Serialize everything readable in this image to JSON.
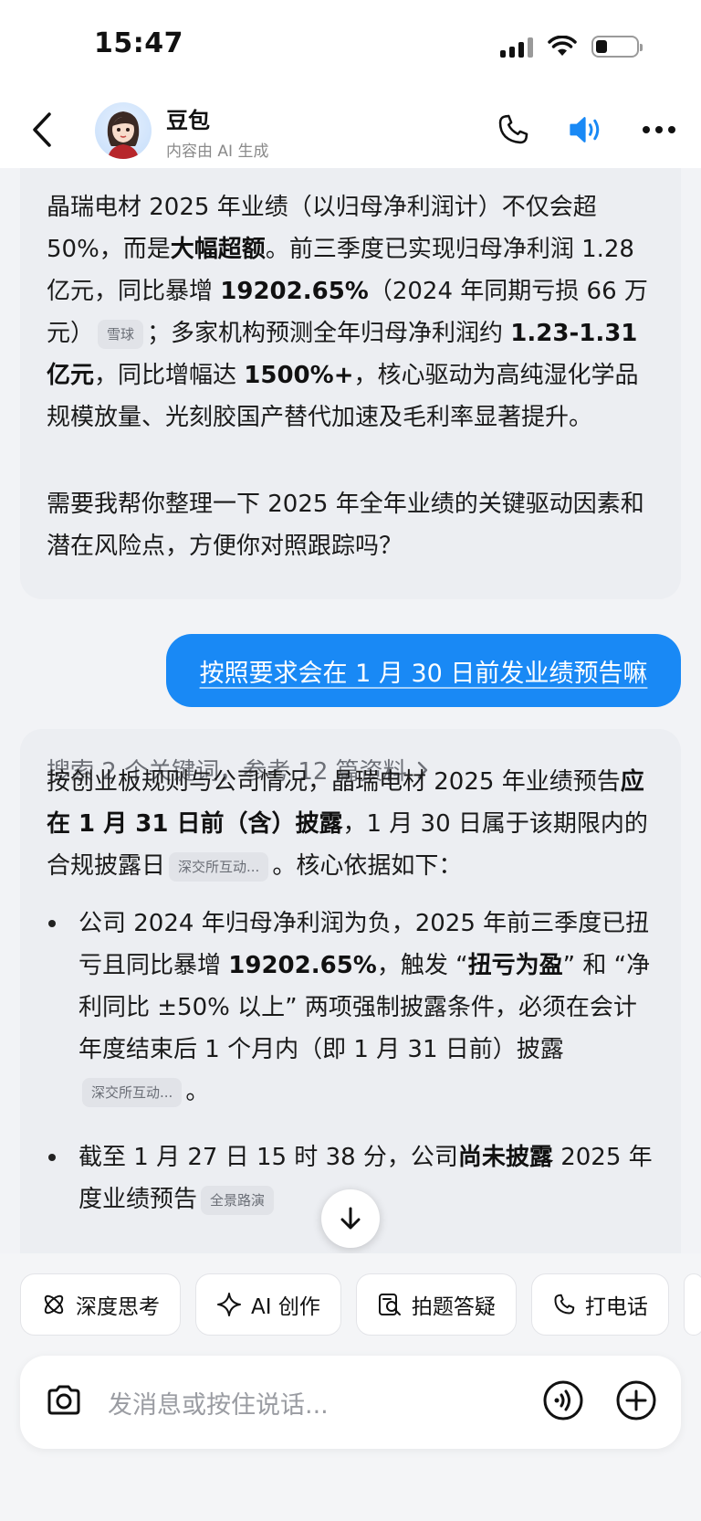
{
  "status_bar": {
    "time": "15:47"
  },
  "header": {
    "title": "豆包",
    "subtitle": "内容由 AI 生成"
  },
  "messages": {
    "ai_1": {
      "p1_pre": "晶瑞电材 2025 年业绩（以归母净利润计）不仅会超 50%，而是",
      "p1_b1": "大幅超额",
      "p1_mid1": "。前三季度已实现归母净利润 1.28 亿元，同比暴增 ",
      "p1_b2": "19202.65%",
      "p1_mid2": "（2024 年同期亏损 66 万元）",
      "cite1": "雪球",
      "p1_mid3": "；多家机构预测全年归母净利润约 ",
      "p1_b3": "1.23-1.31 亿元",
      "p1_mid4": "，同比增幅达 ",
      "p1_b4": "1500%+",
      "p1_end": "，核心驱动为高纯湿化学品规模放量、光刻胶国产替代加速及毛利率显著提升。",
      "p2": "需要我帮你整理一下 2025 年全年业绩的关键驱动因素和潜在风险点，方便你对照跟踪吗？"
    },
    "user_1": "按照要求会在 1 月 30 日前发业绩预告嘛",
    "ai_2": {
      "search": "搜索 2 个关键词，参考 12 篇资料",
      "p1_pre": "按创业板规则与公司情况，晶瑞电材 2025 年业绩预告",
      "p1_b1": "应在 1 月 31 日前（含）披露",
      "p1_mid": "，1 月 30 日属于该期限内的合规披露日",
      "cite1": "深交所互动...",
      "p1_end": "。核心依据如下：",
      "b1_pre": "公司 2024 年归母净利润为负，2025 年前三季度已扭亏且同比暴增 ",
      "b1_b1": "19202.65%",
      "b1_mid1": "，触发 “",
      "b1_b2": "扭亏为盈",
      "b1_mid2": "” 和 “净利同比 ±50% 以上” 两项强制披露条件，必须在会计年度结束后 1 个月内（即 1 月 31 日前）披露",
      "b1_cite": "深交所互动...",
      "b1_end": "。",
      "b2_pre": "截至 1 月 27 日 15 时 38 分，公司",
      "b2_b1": "尚未披露",
      "b2_mid": " 2025 年度业绩预告",
      "b2_cite": "全景路演"
    }
  },
  "quick_actions": [
    {
      "label": "深度思考",
      "icon": "atom-icon"
    },
    {
      "label": "AI 创作",
      "icon": "sparkle-icon"
    },
    {
      "label": "拍题答疑",
      "icon": "scan-question-icon"
    },
    {
      "label": "打电话",
      "icon": "phone-icon"
    }
  ],
  "composer": {
    "placeholder": "发消息或按住说话..."
  },
  "colors": {
    "accent": "#1989f5",
    "bubble_ai": "#eceef2",
    "background": "#f2f3f6"
  }
}
